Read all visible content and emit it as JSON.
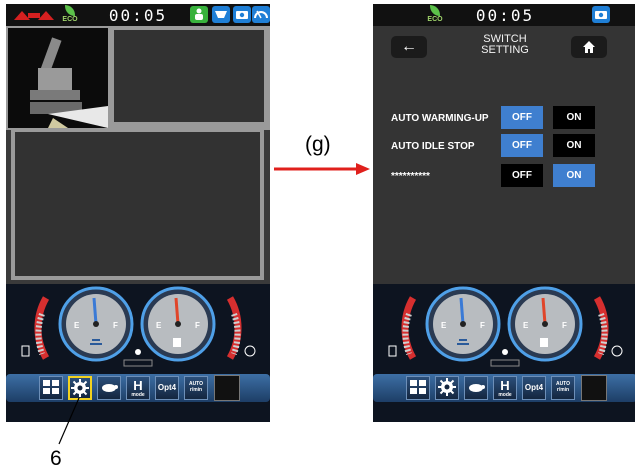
{
  "left_screen": {
    "clock": "00:05",
    "eco_label": "ECO",
    "status_icons": [
      "seatbelt-icon",
      "work-light-icon",
      "camera-icon",
      "wiper-icon"
    ],
    "menu": {
      "opt4_label": "Opt4",
      "hmode_big": "H",
      "hmode_small": "mode",
      "auto_small": "r/min",
      "auto_label": "AUTO",
      "selected_item": "gear"
    },
    "gauges": {
      "left": {
        "empty_label": "E",
        "full_label": "F"
      },
      "right": {
        "empty_label": "E",
        "full_label": "F"
      }
    }
  },
  "right_screen": {
    "clock": "00:05",
    "eco_label": "ECO",
    "title_line1": "SWITCH",
    "title_line2": "SETTING",
    "back_glyph": "←",
    "home_glyph": "⌂",
    "settings": [
      {
        "label": "AUTO WARMING-UP",
        "off": "OFF",
        "on": "ON",
        "selected": "OFF"
      },
      {
        "label": "AUTO IDLE STOP",
        "off": "OFF",
        "on": "ON",
        "selected": "OFF"
      },
      {
        "label": "**********",
        "off": "OFF",
        "on": "ON",
        "selected": "ON"
      }
    ],
    "menu": {
      "opt4_label": "Opt4",
      "hmode_big": "H",
      "hmode_small": "mode",
      "auto_small": "r/min",
      "auto_label": "AUTO"
    },
    "gauges": {
      "left": {
        "empty_label": "E",
        "full_label": "F"
      },
      "right": {
        "empty_label": "E",
        "full_label": "F"
      }
    }
  },
  "annotations": {
    "transition_label": "(g)",
    "callout_number": "6"
  },
  "colors": {
    "active_toggle": "#3f7fcf",
    "inactive_toggle": "#000000",
    "transition_arrow": "#e0201c",
    "selected_highlight": "#f2d21f",
    "temp_needle": "#3a7ad6",
    "fuel_needle": "#e0452a"
  }
}
